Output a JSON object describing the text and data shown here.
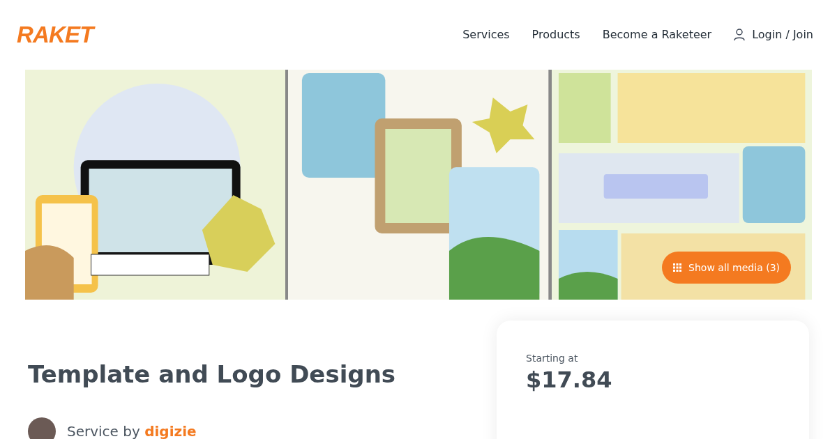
{
  "header": {
    "logo": "RAKET",
    "nav": [
      {
        "label": "Services"
      },
      {
        "label": "Products"
      },
      {
        "label": "Become a Raketeer"
      },
      {
        "label": "Login / Join",
        "kind": "user"
      }
    ]
  },
  "gallery": {
    "show_all": "Show all media (3)"
  },
  "service": {
    "title": "Template and Logo Designs",
    "by_label": "Service by",
    "seller": "digizie"
  },
  "price_card": {
    "label": "Starting at",
    "price": "$17.84"
  }
}
